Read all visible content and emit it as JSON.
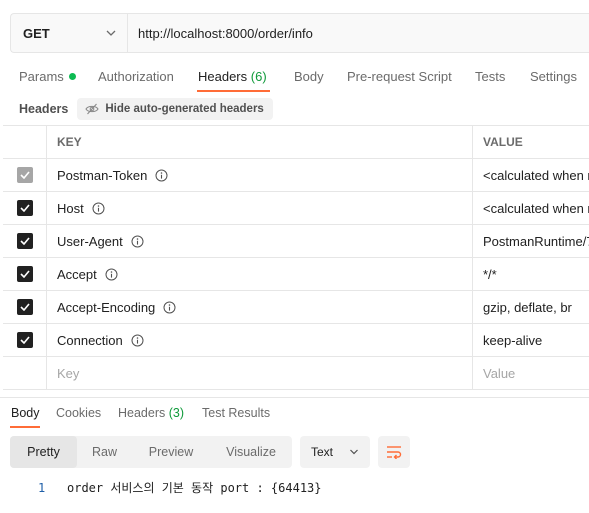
{
  "request": {
    "method": "GET",
    "url": "http://localhost:8000/order/info"
  },
  "request_tabs": [
    {
      "label": "Params"
    },
    {
      "label": "Authorization"
    },
    {
      "label": "Headers",
      "count": "(6)"
    },
    {
      "label": "Body"
    },
    {
      "label": "Pre-request Script"
    },
    {
      "label": "Tests"
    },
    {
      "label": "Settings"
    }
  ],
  "headers_toolbar": {
    "title": "Headers",
    "hide_label": "Hide auto-generated headers"
  },
  "table": {
    "key_header": "KEY",
    "value_header": "VALUE",
    "rows": [
      {
        "key": "Postman-Token",
        "value": "<calculated when r",
        "checked": true,
        "disabled": true
      },
      {
        "key": "Host",
        "value": "<calculated when r",
        "checked": true
      },
      {
        "key": "User-Agent",
        "value": "PostmanRuntime/7",
        "checked": true
      },
      {
        "key": "Accept",
        "value": "*/*",
        "checked": true
      },
      {
        "key": "Accept-Encoding",
        "value": "gzip, deflate, br",
        "checked": true
      },
      {
        "key": "Connection",
        "value": "keep-alive",
        "checked": true
      }
    ],
    "key_placeholder": "Key",
    "value_placeholder": "Value"
  },
  "response_tabs": [
    {
      "label": "Body"
    },
    {
      "label": "Cookies"
    },
    {
      "label": "Headers",
      "count": "(3)"
    },
    {
      "label": "Test Results"
    }
  ],
  "view_options": [
    "Pretty",
    "Raw",
    "Preview",
    "Visualize"
  ],
  "format": "Text",
  "response_body": {
    "line_number": "1",
    "text": "order 서비스의 기본 동작 port : {64413}"
  },
  "colors": {
    "accent": "#ff6c37",
    "count_green": "#0f9a3a",
    "dot_green": "#0cbb52"
  }
}
